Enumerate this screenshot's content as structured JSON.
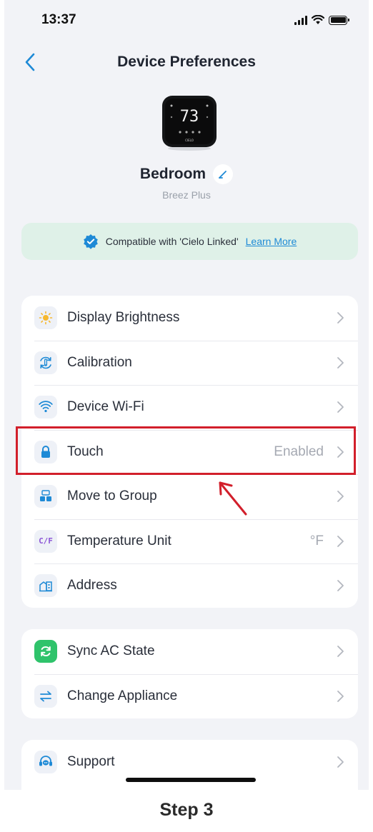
{
  "status_bar": {
    "time": "13:37"
  },
  "header": {
    "title": "Device Preferences"
  },
  "device": {
    "display_temp": "73",
    "brand_mark": "CIELO",
    "name": "Bedroom",
    "model": "Breez Plus"
  },
  "banner": {
    "text": "Compatible with 'Cielo Linked'",
    "link": "Learn More"
  },
  "settings": [
    {
      "label": "Display Brightness",
      "value": "",
      "icon": "sun-icon"
    },
    {
      "label": "Calibration",
      "value": "",
      "icon": "calibration-icon"
    },
    {
      "label": "Device Wi-Fi",
      "value": "",
      "icon": "wifi-icon"
    },
    {
      "label": "Touch",
      "value": "Enabled",
      "icon": "lock-icon"
    },
    {
      "label": "Move to Group",
      "value": "",
      "icon": "group-icon"
    },
    {
      "label": "Temperature Unit",
      "value": "°F",
      "icon": "cf-icon",
      "icon_text": "C/F"
    },
    {
      "label": "Address",
      "value": "",
      "icon": "building-icon"
    }
  ],
  "actions": [
    {
      "label": "Sync AC State",
      "icon": "sync-icon"
    },
    {
      "label": "Change Appliance",
      "icon": "swap-icon"
    }
  ],
  "support": [
    {
      "label": "Support",
      "icon": "headset-icon"
    }
  ],
  "annotation": {
    "step_label": "Step 3"
  },
  "colors": {
    "accent": "#1e8ad6",
    "highlight": "#d21f2b",
    "banner_bg": "#dff1e8",
    "sync_green": "#2fc36b"
  }
}
